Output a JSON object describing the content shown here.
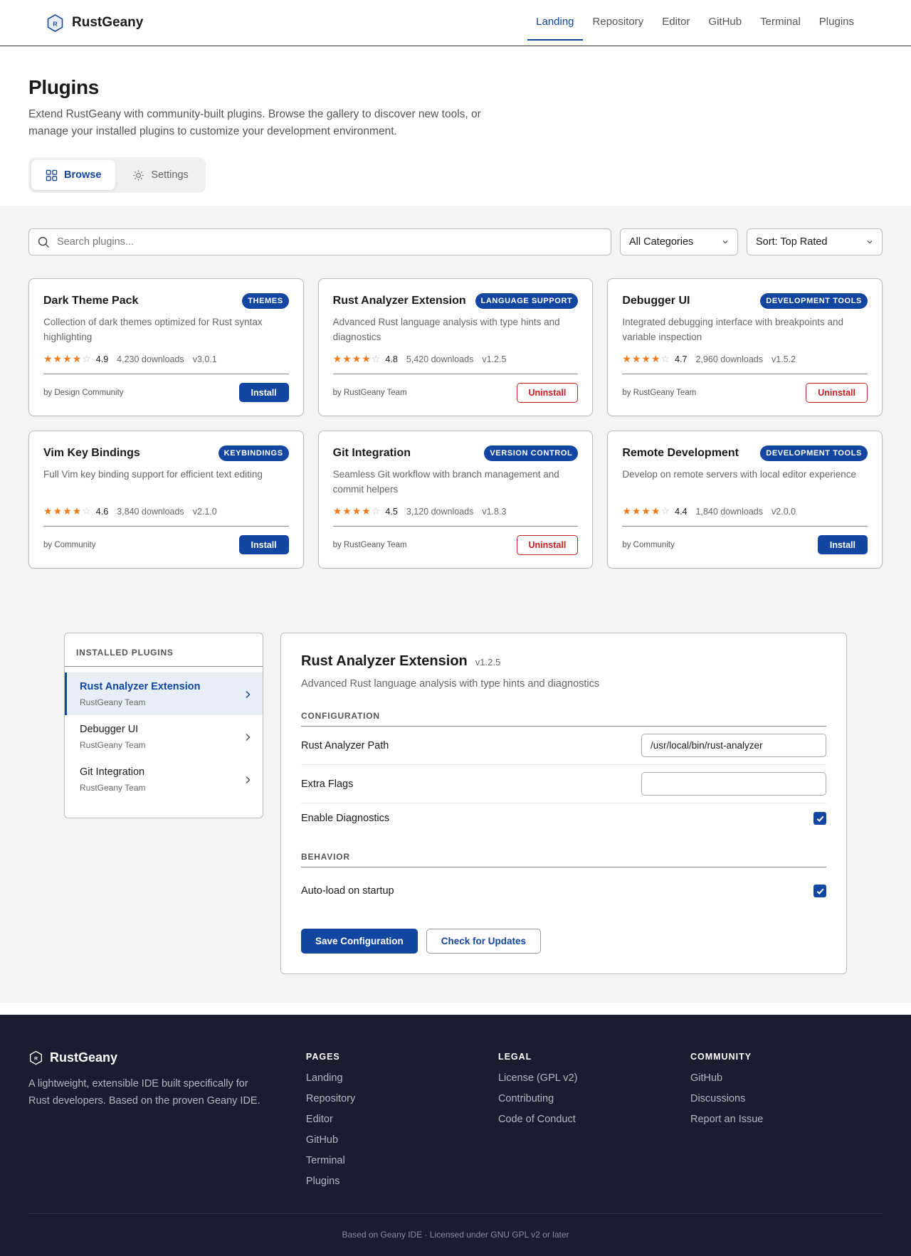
{
  "brand": {
    "name": "RustGeany",
    "logo_letter": "R"
  },
  "nav": [
    {
      "label": "Landing",
      "active": true
    },
    {
      "label": "Repository",
      "active": false
    },
    {
      "label": "Editor",
      "active": false
    },
    {
      "label": "GitHub",
      "active": false
    },
    {
      "label": "Terminal",
      "active": false
    },
    {
      "label": "Plugins",
      "active": false
    }
  ],
  "hero": {
    "title": "Plugins",
    "description": "Extend RustGeany with community-built plugins. Browse the gallery to discover new tools, or manage your installed plugins to customize your development environment."
  },
  "tabs": {
    "browse": "Browse",
    "settings": "Settings"
  },
  "filters": {
    "search_placeholder": "Search plugins...",
    "category": "All Categories",
    "sort": "Sort: Top Rated"
  },
  "plugins": [
    {
      "name": "Dark Theme Pack",
      "badge": "THEMES",
      "description": "Collection of dark themes optimized for Rust syntax highlighting",
      "stars": 4,
      "rating": "4.9",
      "downloads": "4,230 downloads",
      "version": "v3.0.1",
      "author": "by Design Community",
      "action": "Install"
    },
    {
      "name": "Rust Analyzer Extension",
      "badge": "LANGUAGE SUPPORT",
      "description": "Advanced Rust language analysis with type hints and diagnostics",
      "stars": 4,
      "rating": "4.8",
      "downloads": "5,420 downloads",
      "version": "v1.2.5",
      "author": "by RustGeany Team",
      "action": "Uninstall"
    },
    {
      "name": "Debugger UI",
      "badge": "DEVELOPMENT TOOLS",
      "description": "Integrated debugging interface with breakpoints and variable inspection",
      "stars": 4,
      "rating": "4.7",
      "downloads": "2,960 downloads",
      "version": "v1.5.2",
      "author": "by RustGeany Team",
      "action": "Uninstall"
    },
    {
      "name": "Vim Key Bindings",
      "badge": "KEYBINDINGS",
      "description": "Full Vim key binding support for efficient text editing",
      "stars": 4,
      "rating": "4.6",
      "downloads": "3,840 downloads",
      "version": "v2.1.0",
      "author": "by Community",
      "action": "Install"
    },
    {
      "name": "Git Integration",
      "badge": "VERSION CONTROL",
      "description": "Seamless Git workflow with branch management and commit helpers",
      "stars": 4,
      "rating": "4.5",
      "downloads": "3,120 downloads",
      "version": "v1.8.3",
      "author": "by RustGeany Team",
      "action": "Uninstall"
    },
    {
      "name": "Remote Development",
      "badge": "DEVELOPMENT TOOLS",
      "description": "Develop on remote servers with local editor experience",
      "stars": 4,
      "rating": "4.4",
      "downloads": "1,840 downloads",
      "version": "v2.0.0",
      "author": "by Community",
      "action": "Install"
    }
  ],
  "installed": {
    "heading": "INSTALLED PLUGINS",
    "items": [
      {
        "name": "Rust Analyzer Extension",
        "author": "RustGeany Team",
        "active": true
      },
      {
        "name": "Debugger UI",
        "author": "RustGeany Team",
        "active": false
      },
      {
        "name": "Git Integration",
        "author": "RustGeany Team",
        "active": false
      }
    ]
  },
  "detail": {
    "title": "Rust Analyzer Extension",
    "version": "v1.2.5",
    "description": "Advanced Rust language analysis with type hints and diagnostics",
    "config_label": "CONFIGURATION",
    "path_label": "Rust Analyzer Path",
    "path_value": "/usr/local/bin/rust-analyzer",
    "flags_label": "Extra Flags",
    "flags_value": "",
    "diagnostics_label": "Enable Diagnostics",
    "diagnostics_checked": true,
    "behavior_label": "BEHAVIOR",
    "autoload_label": "Auto-load on startup",
    "autoload_checked": true,
    "save_label": "Save Configuration",
    "check_label": "Check for Updates"
  },
  "footer": {
    "brand": "RustGeany",
    "description": "A lightweight, extensible IDE built specifically for Rust developers. Based on the proven Geany IDE.",
    "pages_heading": "PAGES",
    "pages": [
      "Landing",
      "Repository",
      "Editor",
      "GitHub",
      "Terminal",
      "Plugins"
    ],
    "legal_heading": "LEGAL",
    "legal": [
      "License (GPL v2)",
      "Contributing",
      "Code of Conduct"
    ],
    "community_heading": "COMMUNITY",
    "community": [
      "GitHub",
      "Discussions",
      "Report an Issue"
    ],
    "bottom": "Based on Geany IDE · Licensed under GNU GPL v2 or later"
  },
  "colors": {
    "accent": "#1346a0",
    "danger": "#c52020",
    "star": "#f07a1a",
    "footer_bg": "#1c1c30"
  }
}
